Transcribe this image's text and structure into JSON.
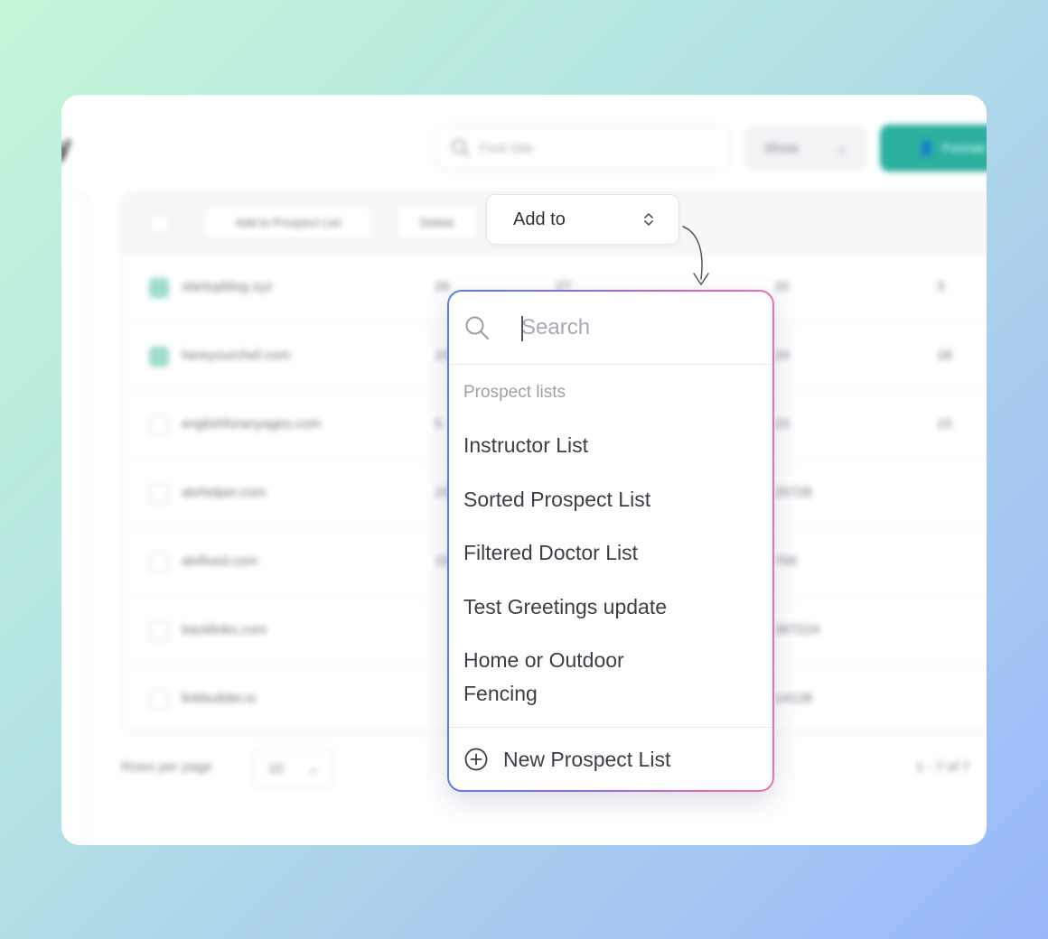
{
  "page": {
    "title_fragment": "y",
    "search_placeholder": "Find Site",
    "show_label": "Show",
    "primary_button_label": "Format",
    "toolbar": {
      "add_to_prospect_list": "Add to Prospect List",
      "delete": "Delete"
    },
    "rows": [
      {
        "site": "startupblog.xyz",
        "c1": "26",
        "c2": "27",
        "c3": "20",
        "c4": "3",
        "checked": true
      },
      {
        "site": "hereyourchef.com",
        "c1": "10",
        "c2": "",
        "c3": "24",
        "c4": "18",
        "checked": true
      },
      {
        "site": "englishforanyages.com",
        "c1": "5",
        "c2": "",
        "c3": "23",
        "c4": "15",
        "checked": false
      },
      {
        "site": "atvhelper.com",
        "c1": "23",
        "c2": "",
        "c3": "25728",
        "c4": "",
        "checked": false
      },
      {
        "site": "atvfixed.com",
        "c1": "15",
        "c2": "",
        "c3": "700",
        "c4": "",
        "checked": false
      },
      {
        "site": "backlinks.com",
        "c1": "",
        "c2": "",
        "c3": "367224",
        "c4": "",
        "checked": false
      },
      {
        "site": "linkbuilder.io",
        "c1": "",
        "c2": "",
        "c3": "14128",
        "c4": "",
        "checked": false
      }
    ],
    "rows_per_page_label": "Rows per page",
    "rows_per_page_value": "10",
    "pagination": "1 - 7 of 7"
  },
  "add_to": {
    "label": "Add to"
  },
  "dropdown": {
    "search_placeholder": "Search",
    "section_label": "Prospect lists",
    "items": [
      "Instructor List",
      "Sorted Prospect List",
      "Filtered Doctor List",
      "Test Greetings update",
      "Home or Outdoor Fencing"
    ],
    "new_list_label": "New Prospect List"
  },
  "icons": {
    "search": "search-icon",
    "chevron_up_down": "chevron-up-down-icon",
    "plus_circle": "plus-circle-icon",
    "arrow_doodle": "curved-arrow-icon"
  },
  "colors": {
    "accent": "#2bb0a0",
    "dropdown_border_start": "#5b7cf0",
    "dropdown_border_end": "#ef6fb4"
  }
}
